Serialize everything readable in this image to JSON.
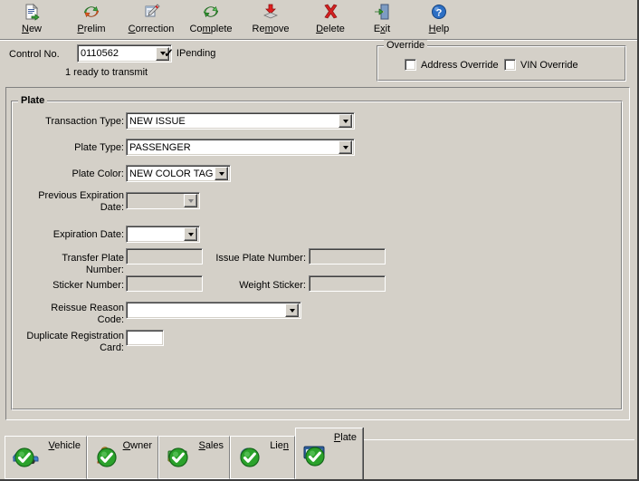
{
  "toolbar": {
    "buttons": [
      {
        "name": "new",
        "label_pre": "",
        "label_key": "N",
        "label_post": "ew",
        "icon": "new-document-icon"
      },
      {
        "name": "prelim",
        "label_pre": "",
        "label_key": "P",
        "label_post": "relim",
        "icon": "refresh-arrows-icon"
      },
      {
        "name": "correction",
        "label_pre": "",
        "label_key": "C",
        "label_post": "orrection",
        "icon": "clipboard-pen-icon"
      },
      {
        "name": "complete",
        "label_pre": "Co",
        "label_key": "m",
        "label_post": "plete",
        "icon": "green-refresh-icon"
      },
      {
        "name": "remove",
        "label_pre": "Re",
        "label_key": "m",
        "label_post": "ove",
        "icon": "remove-arrow-icon"
      },
      {
        "name": "delete",
        "label_pre": "",
        "label_key": "D",
        "label_post": "elete",
        "icon": "red-x-icon"
      },
      {
        "name": "exit",
        "label_pre": "E",
        "label_key": "x",
        "label_post": "it",
        "icon": "exit-door-icon"
      },
      {
        "name": "help",
        "label_pre": "",
        "label_key": "H",
        "label_post": "elp",
        "icon": "help-question-icon"
      }
    ]
  },
  "control": {
    "label": "Control No.",
    "value": "0110562",
    "pending_check": "✓",
    "pending_label": "IPending",
    "status_text": "1 ready to transmit"
  },
  "override": {
    "title": "Override",
    "address_override_label": "Address Override",
    "address_override_checked": false,
    "vin_override_label": "VIN Override",
    "vin_override_checked": false
  },
  "plate": {
    "group_title": "Plate",
    "transaction_type": {
      "label": "Transaction Type:",
      "value": "NEW ISSUE"
    },
    "plate_type": {
      "label": "Plate Type:",
      "value": "PASSENGER"
    },
    "plate_color": {
      "label": "Plate Color:",
      "value": "NEW COLOR TAG"
    },
    "previous_expiration_date": {
      "label": "Previous Expiration Date:",
      "value": ""
    },
    "expiration_date": {
      "label": "Expiration Date:",
      "value": ""
    },
    "transfer_plate_number": {
      "label": "Transfer Plate Number:",
      "value": ""
    },
    "issue_plate_number": {
      "label": "Issue Plate Number:",
      "value": ""
    },
    "sticker_number": {
      "label": "Sticker Number:",
      "value": ""
    },
    "weight_sticker": {
      "label": "Weight Sticker:",
      "value": ""
    },
    "reissue_reason_code": {
      "label": "Reissue Reason Code:",
      "value": ""
    },
    "duplicate_registration_card": {
      "label": "Duplicate Registration Card:",
      "value": ""
    }
  },
  "tabs": [
    {
      "name": "vehicle",
      "label_pre": "",
      "label_key": "V",
      "label_post": "ehicle",
      "icon": "car-icon",
      "status": "complete",
      "active": false
    },
    {
      "name": "owner",
      "label_pre": "",
      "label_key": "O",
      "label_post": "wner",
      "icon": "person-icon",
      "status": "complete",
      "active": false
    },
    {
      "name": "sales",
      "label_pre": "",
      "label_key": "S",
      "label_post": "ales",
      "icon": "money-icon",
      "status": "complete",
      "active": false
    },
    {
      "name": "lien",
      "label_pre": "Lien",
      "label_key": "",
      "label_post": "",
      "icon": "dollar-globe-icon",
      "status": "complete",
      "active": false
    },
    {
      "name": "plate",
      "label_pre": "",
      "label_key": "P",
      "label_post": "late",
      "icon": "license-plate-icon",
      "status": "complete",
      "active": true
    }
  ],
  "colors": {
    "window_bg": "#d4d0c8",
    "field_bg": "#ffffff",
    "disabled_bg": "#d4d0c8",
    "check_green": "#2ba22b",
    "delete_red": "#d42020",
    "help_blue": "#2d6fc4"
  }
}
